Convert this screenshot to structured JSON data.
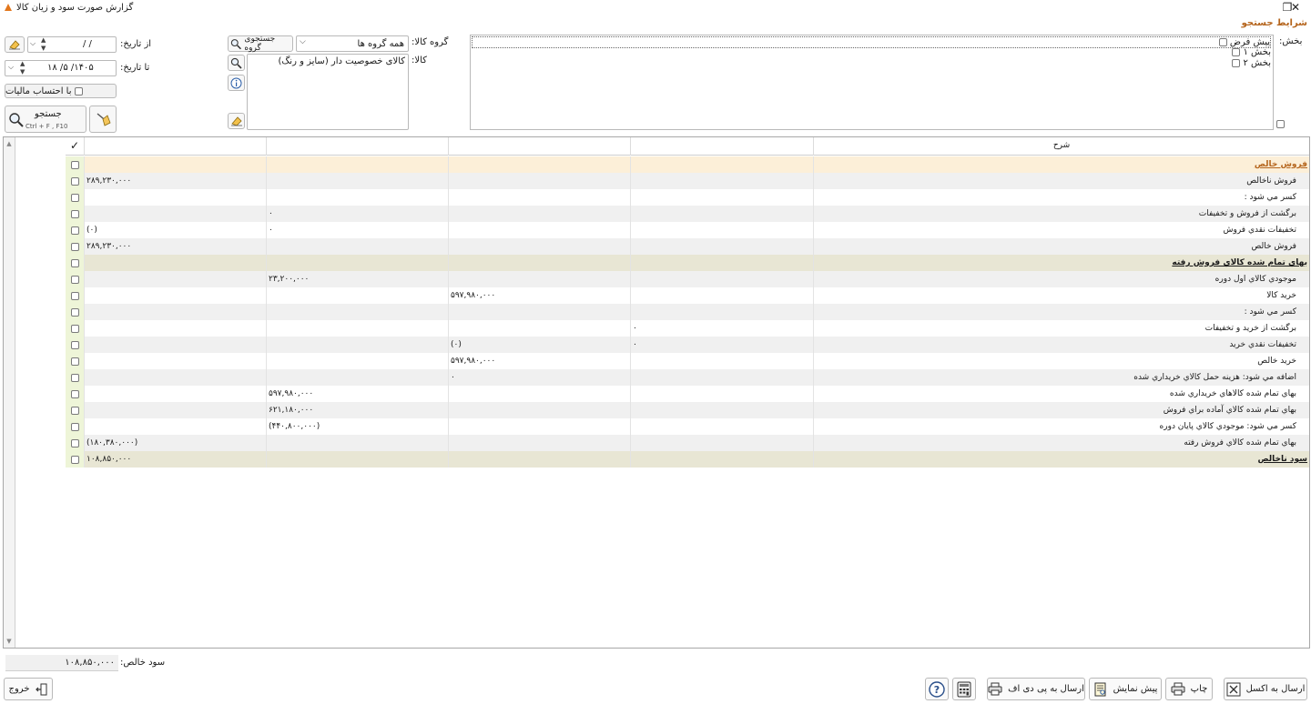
{
  "window": {
    "title": "گزارش صورت سود و زیان کالا",
    "restore_glyph": "❐",
    "close_glyph": "✕"
  },
  "search_section": {
    "title": "شرايط جستجو"
  },
  "filters": {
    "from_date_label": "از تاريخ:",
    "from_date_value": "/   /",
    "to_date_label": "تا تاريخ:",
    "to_date_value": "۱۴۰۵/ ۵/ ۱۸",
    "tax_checkbox_label": "با احتساب ماليات",
    "search_button_label": "جستجو",
    "search_button_shortcut": "Ctrl + F , F10",
    "product_group_label": "گروه کالا:",
    "product_group_value": "همه گروه ها",
    "group_search_button": "جستجوی گروه",
    "product_label": "کالا:",
    "product_value": "کالای خصوصيت دار (سايز و رنگ)",
    "section_label": "بخش:",
    "sections": [
      "پيش فرض",
      "بخش ۱",
      "بخش ۲"
    ]
  },
  "grid": {
    "header_check": "✓",
    "header_desc": "شرح",
    "rows": [
      {
        "type": "heading",
        "desc": "فروش خالص",
        "c1": "",
        "c2": "",
        "c3": "",
        "c4": ""
      },
      {
        "type": "alt",
        "desc": "فروش ناخالص",
        "c1": "۲۸۹,۲۳۰,۰۰۰",
        "c2": "",
        "c3": "",
        "c4": ""
      },
      {
        "type": "plain",
        "desc": "کسر مي شود :",
        "c1": "",
        "c2": "",
        "c3": "",
        "c4": ""
      },
      {
        "type": "alt",
        "desc": "برگشت از فروش و تخفيفات",
        "c1": "",
        "c2": "۰",
        "c3": "",
        "c4": ""
      },
      {
        "type": "plain",
        "desc": "تخفيفات نقدي فروش",
        "c1": "(۰)",
        "c2": "۰",
        "c3": "",
        "c4": ""
      },
      {
        "type": "alt",
        "desc": "فروش خالص",
        "c1": "۲۸۹,۲۳۰,۰۰۰",
        "c2": "",
        "c3": "",
        "c4": ""
      },
      {
        "type": "subtotal",
        "desc": "بهاي تمام شده کالاي فروش رفته",
        "c1": "",
        "c2": "",
        "c3": "",
        "c4": ""
      },
      {
        "type": "alt",
        "desc": "موجودي کالاي اول دوره",
        "c1": "",
        "c2": "۲۳,۲۰۰,۰۰۰",
        "c3": "",
        "c4": ""
      },
      {
        "type": "plain",
        "desc": "خريد کالا",
        "c1": "",
        "c2": "",
        "c3": "۵۹۷,۹۸۰,۰۰۰",
        "c4": ""
      },
      {
        "type": "alt",
        "desc": "کسر مي شود :",
        "c1": "",
        "c2": "",
        "c3": "",
        "c4": ""
      },
      {
        "type": "plain",
        "desc": "برگشت از خريد و تخفيفات",
        "c1": "",
        "c2": "",
        "c3": "",
        "c4": "۰"
      },
      {
        "type": "alt",
        "desc": "تخفيفات نقدي خريد",
        "c1": "",
        "c2": "",
        "c3": "(۰)",
        "c4": "۰"
      },
      {
        "type": "plain",
        "desc": "خريد خالص",
        "c1": "",
        "c2": "",
        "c3": "۵۹۷,۹۸۰,۰۰۰",
        "c4": ""
      },
      {
        "type": "alt",
        "desc": "اضافه مي شود: هزينه حمل کالاي خريداري شده",
        "c1": "",
        "c2": "",
        "c3": "۰",
        "c4": ""
      },
      {
        "type": "plain",
        "desc": "بهاي تمام شده کالاهاي خريداري شده",
        "c1": "",
        "c2": "۵۹۷,۹۸۰,۰۰۰",
        "c3": "",
        "c4": ""
      },
      {
        "type": "alt",
        "desc": "بهاي تمام شده کالاي آماده براي فروش",
        "c1": "",
        "c2": "۶۲۱,۱۸۰,۰۰۰",
        "c3": "",
        "c4": ""
      },
      {
        "type": "plain",
        "desc": "کسر مي شود: موجودي کالاي پايان دوره",
        "c1": "",
        "c2": "(۴۴۰,۸۰۰,۰۰۰)",
        "c3": "",
        "c4": ""
      },
      {
        "type": "alt",
        "desc": "بهاي تمام شده کالاي فروش رفته",
        "c1": "(۱۸۰,۳۸۰,۰۰۰)",
        "c2": "",
        "c3": "",
        "c4": ""
      },
      {
        "type": "total",
        "desc": "سود ناخالص",
        "c1": "۱۰۸,۸۵۰,۰۰۰",
        "c2": "",
        "c3": "",
        "c4": ""
      }
    ]
  },
  "footer": {
    "net_profit_label": "سود خالص:",
    "net_profit_value": "۱۰۸,۸۵۰,۰۰۰"
  },
  "actions": {
    "exit": "خروج",
    "excel": "ارسال به اکسل",
    "print": "چاپ",
    "preview": "پيش نمايش",
    "pdf": "ارسال به پی دی اف"
  }
}
